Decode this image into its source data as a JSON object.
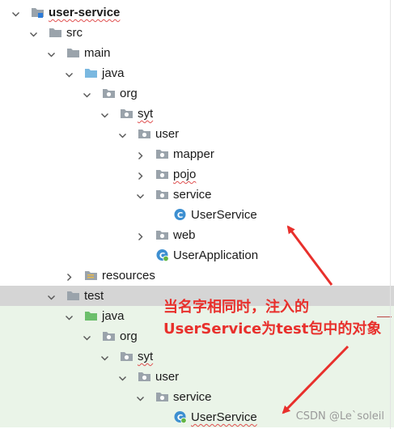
{
  "tree": [
    {
      "label": "user-service",
      "type": "module",
      "depth": 0,
      "expanded": true,
      "bold": true,
      "squiggle": true
    },
    {
      "label": "src",
      "type": "folder",
      "depth": 1,
      "expanded": true
    },
    {
      "label": "main",
      "type": "folder",
      "depth": 2,
      "expanded": true
    },
    {
      "label": "java",
      "type": "src-root",
      "depth": 3,
      "expanded": true
    },
    {
      "label": "org",
      "type": "package",
      "depth": 4,
      "expanded": true
    },
    {
      "label": "syt",
      "type": "package",
      "depth": 5,
      "expanded": true,
      "squiggle": true
    },
    {
      "label": "user",
      "type": "package",
      "depth": 6,
      "expanded": true
    },
    {
      "label": "mapper",
      "type": "package",
      "depth": 7,
      "expanded": false
    },
    {
      "label": "pojo",
      "type": "package",
      "depth": 7,
      "expanded": false,
      "squiggle": true
    },
    {
      "label": "service",
      "type": "package",
      "depth": 7,
      "expanded": true
    },
    {
      "label": "UserService",
      "type": "class",
      "depth": 8
    },
    {
      "label": "web",
      "type": "package",
      "depth": 7,
      "expanded": false
    },
    {
      "label": "UserApplication",
      "type": "spring-class",
      "depth": 7
    },
    {
      "label": "resources",
      "type": "resources",
      "depth": 3,
      "expanded": false
    },
    {
      "label": "test",
      "type": "folder",
      "depth": 2,
      "expanded": true,
      "selected": true
    },
    {
      "label": "java",
      "type": "test-root",
      "depth": 3,
      "expanded": true,
      "test": true
    },
    {
      "label": "org",
      "type": "package",
      "depth": 4,
      "expanded": true,
      "test": true
    },
    {
      "label": "syt",
      "type": "package",
      "depth": 5,
      "expanded": true,
      "test": true,
      "squiggle": true
    },
    {
      "label": "user",
      "type": "package",
      "depth": 6,
      "expanded": true,
      "test": true
    },
    {
      "label": "service",
      "type": "package",
      "depth": 7,
      "expanded": true,
      "test": true
    },
    {
      "label": "UserService",
      "type": "spring-class",
      "depth": 8,
      "test": true,
      "squiggle": true
    }
  ],
  "annotation": {
    "line1": "当名字相同时，注入的",
    "line2": "UserService为test包中的对象"
  },
  "watermark": "CSDN @Le`soleil",
  "colors": {
    "selection": "#d5d5d5",
    "test_area": "#eaf4e8",
    "annotation": "#e8302c",
    "folder": "#9aa3ab",
    "src_root": "#7ab8e0",
    "test_root": "#6cbf6c",
    "class_icon": "#3d8fd1"
  }
}
